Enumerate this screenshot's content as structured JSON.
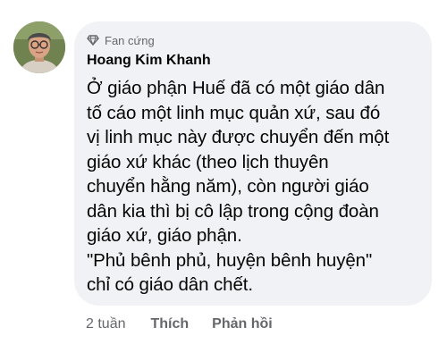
{
  "comment": {
    "badge": "Fan cứng",
    "badge_icon": "diamond-icon",
    "author": "Hoang Kim Khanh",
    "lines": [
      "Ở giáo phận Huế đã có một giáo dân",
      "tố cáo một linh mục quản xứ, sau đó",
      "vị linh mục này được chuyển đến một",
      "giáo xứ khác (theo lịch thuyên",
      "chuyển hằng năm), còn người giáo",
      "dân kia thì bị cô lập trong cộng đoàn",
      "giáo xứ, giáo phận.",
      "\"Phủ bênh phủ, huyện bênh huyện\"",
      "chỉ có giáo dân chết."
    ],
    "timestamp": "2 tuần",
    "like_label": "Thích",
    "reply_label": "Phản hồi"
  },
  "colors": {
    "bubble_bg": "#f0f2f5",
    "text": "#050505",
    "secondary": "#65676b"
  }
}
